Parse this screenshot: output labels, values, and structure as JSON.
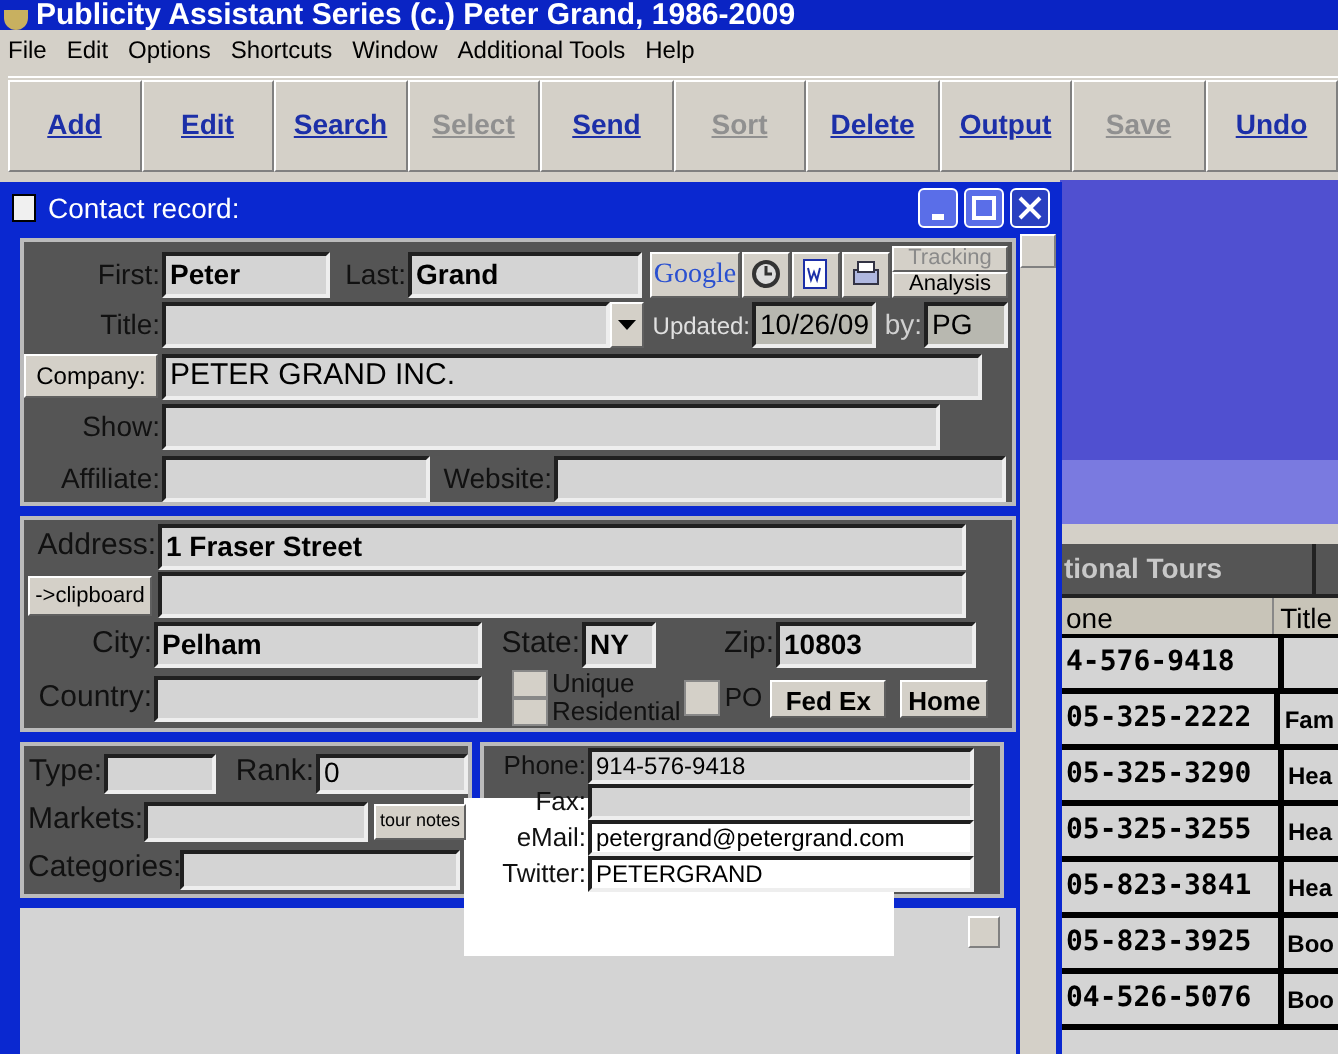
{
  "app": {
    "title": "Publicity Assistant Series (c.) Peter Grand, 1986-2009",
    "menu": [
      "File",
      "Edit",
      "Options",
      "Shortcuts",
      "Window",
      "Additional Tools",
      "Help"
    ],
    "toolbar": [
      {
        "label": "Add",
        "disabled": false
      },
      {
        "label": "Edit",
        "disabled": false
      },
      {
        "label": "Search",
        "disabled": false
      },
      {
        "label": "Select",
        "disabled": true
      },
      {
        "label": "Send",
        "disabled": false
      },
      {
        "label": "Sort",
        "disabled": true
      },
      {
        "label": "Delete",
        "disabled": false
      },
      {
        "label": "Output",
        "disabled": false
      },
      {
        "label": "Save",
        "disabled": true
      },
      {
        "label": "Undo",
        "disabled": false
      }
    ]
  },
  "background_list": {
    "tab": "tional Tours",
    "columns": [
      "one",
      "Title"
    ],
    "rows": [
      [
        "4-576-9418",
        ""
      ],
      [
        "05-325-2222",
        "Fam"
      ],
      [
        "05-325-3290",
        "Hea"
      ],
      [
        "05-325-3255",
        "Hea"
      ],
      [
        "05-823-3841",
        "Hea"
      ],
      [
        "05-823-3925",
        "Boo"
      ],
      [
        "04-526-5076",
        "Boo"
      ]
    ]
  },
  "contact": {
    "title": "Contact record:",
    "first": {
      "label": "First:",
      "value": "Peter"
    },
    "last": {
      "label": "Last:",
      "value": "Grand"
    },
    "google": "Google",
    "tracking": {
      "label": "Tracking",
      "disabled": true
    },
    "analysis": {
      "label": "Analysis",
      "disabled": false
    },
    "title_field": {
      "label": "Title:"
    },
    "updated": {
      "label": "Updated:",
      "value": "10/26/09"
    },
    "by": {
      "label": "by:",
      "value": "PG"
    },
    "company": {
      "label": "Company:",
      "value": "PETER GRAND INC."
    },
    "show": {
      "label": "Show:"
    },
    "affiliate": {
      "label": "Affiliate:"
    },
    "website": {
      "label": "Website:"
    },
    "address": {
      "label": "Address:",
      "value": "1 Fraser Street"
    },
    "clipboard": "->clipboard",
    "city": {
      "label": "City:",
      "value": "Pelham"
    },
    "state": {
      "label": "State:",
      "value": "NY"
    },
    "zip": {
      "label": "Zip:",
      "value": "10803"
    },
    "country": {
      "label": "Country:"
    },
    "checkboxes": [
      {
        "label": "Unique",
        "checked": false
      },
      {
        "label": "Residential",
        "checked": false
      },
      {
        "label": "PO",
        "checked": false
      }
    ],
    "fedex": "Fed Ex",
    "home": "Home",
    "type": {
      "label": "Type:"
    },
    "rank": {
      "label": "Rank:",
      "value": "0"
    },
    "markets": {
      "label": "Markets:"
    },
    "tour_notes": "tour notes",
    "categories": {
      "label": "Categories:"
    },
    "phone": {
      "label": "Phone:",
      "value": "914-576-9418"
    },
    "fax": {
      "label": "Fax:"
    },
    "email": {
      "label": "eMail:",
      "value": "petergrand@petergrand.com"
    },
    "twitter": {
      "label": "Twitter:",
      "value": "PETERGRAND"
    }
  }
}
